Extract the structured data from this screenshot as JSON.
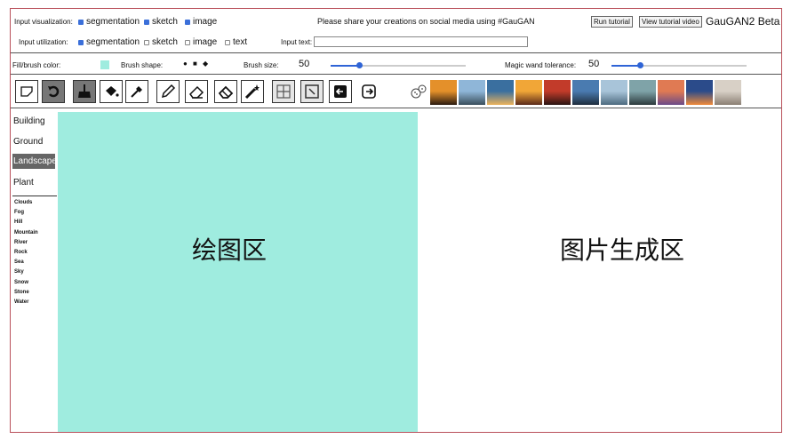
{
  "top": {
    "input_visualization_label": "Input visualization:",
    "vis_options": [
      {
        "label": "segmentation",
        "checked": true
      },
      {
        "label": "sketch",
        "checked": true
      },
      {
        "label": "image",
        "checked": true
      }
    ],
    "share_text": "Please share your creations on social media using #GauGAN",
    "run_tutorial": "Run tutorial",
    "view_tutorial_video": "View tutorial video",
    "app_title": "GauGAN2 Beta",
    "input_utilization_label": "Input utilization:",
    "util_options": [
      {
        "label": "segmentation",
        "checked": true
      },
      {
        "label": "sketch",
        "checked": false
      },
      {
        "label": "image",
        "checked": false
      },
      {
        "label": "text",
        "checked": false
      }
    ],
    "input_text_label": "Input text:",
    "input_text_value": ""
  },
  "brush": {
    "fill_label": "Fill/brush color:",
    "fill_color": "#9fecdf",
    "shape_label": "Brush shape:",
    "shapes": [
      "●",
      "■",
      "◆"
    ],
    "size_label": "Brush size:",
    "size_value": "50",
    "size_fraction": 0.21,
    "wand_label": "Magic wand tolerance:",
    "wand_value": "50",
    "wand_fraction": 0.21
  },
  "tools": [
    "select-tool-icon",
    "undo-icon",
    "broom-icon",
    "fill-bucket-icon",
    "eyedropper-icon",
    "pencil-icon",
    "eraser-icon",
    "rubber-eraser-icon",
    "magic-wand-icon",
    "grid-icon",
    "image-edit-icon",
    "arrow-left-box-icon",
    "arrow-right-box-icon",
    "dice-icon"
  ],
  "style_thumb_colors": [
    [
      "#e4902a",
      "#2b1b10"
    ],
    [
      "#8fb6d8",
      "#3a4e5c"
    ],
    [
      "#3a6f9f",
      "#ecb35b"
    ],
    [
      "#f1a637",
      "#5a2a1a"
    ],
    [
      "#c23b2a",
      "#2a1412"
    ],
    [
      "#4a7bb0",
      "#1e2d3d"
    ],
    [
      "#a8c4d9",
      "#4e6b7f"
    ],
    [
      "#7fa3a8",
      "#2c3a3c"
    ],
    [
      "#e07a53",
      "#6b4a88"
    ],
    [
      "#2b4b8a",
      "#f08a3a"
    ],
    [
      "#d8d0c6",
      "#8b7f74"
    ]
  ],
  "sidebar": {
    "categories": [
      "Building",
      "Ground",
      "Landscape",
      "Plant"
    ],
    "selected": "Landscape",
    "sub_items": [
      "Clouds",
      "Fog",
      "Hill",
      "Mountain",
      "River",
      "Rock",
      "Sea",
      "Sky",
      "Snow",
      "Stone",
      "Water"
    ]
  },
  "canvas": {
    "left_label": "绘图区",
    "right_label": "图片生成区"
  }
}
